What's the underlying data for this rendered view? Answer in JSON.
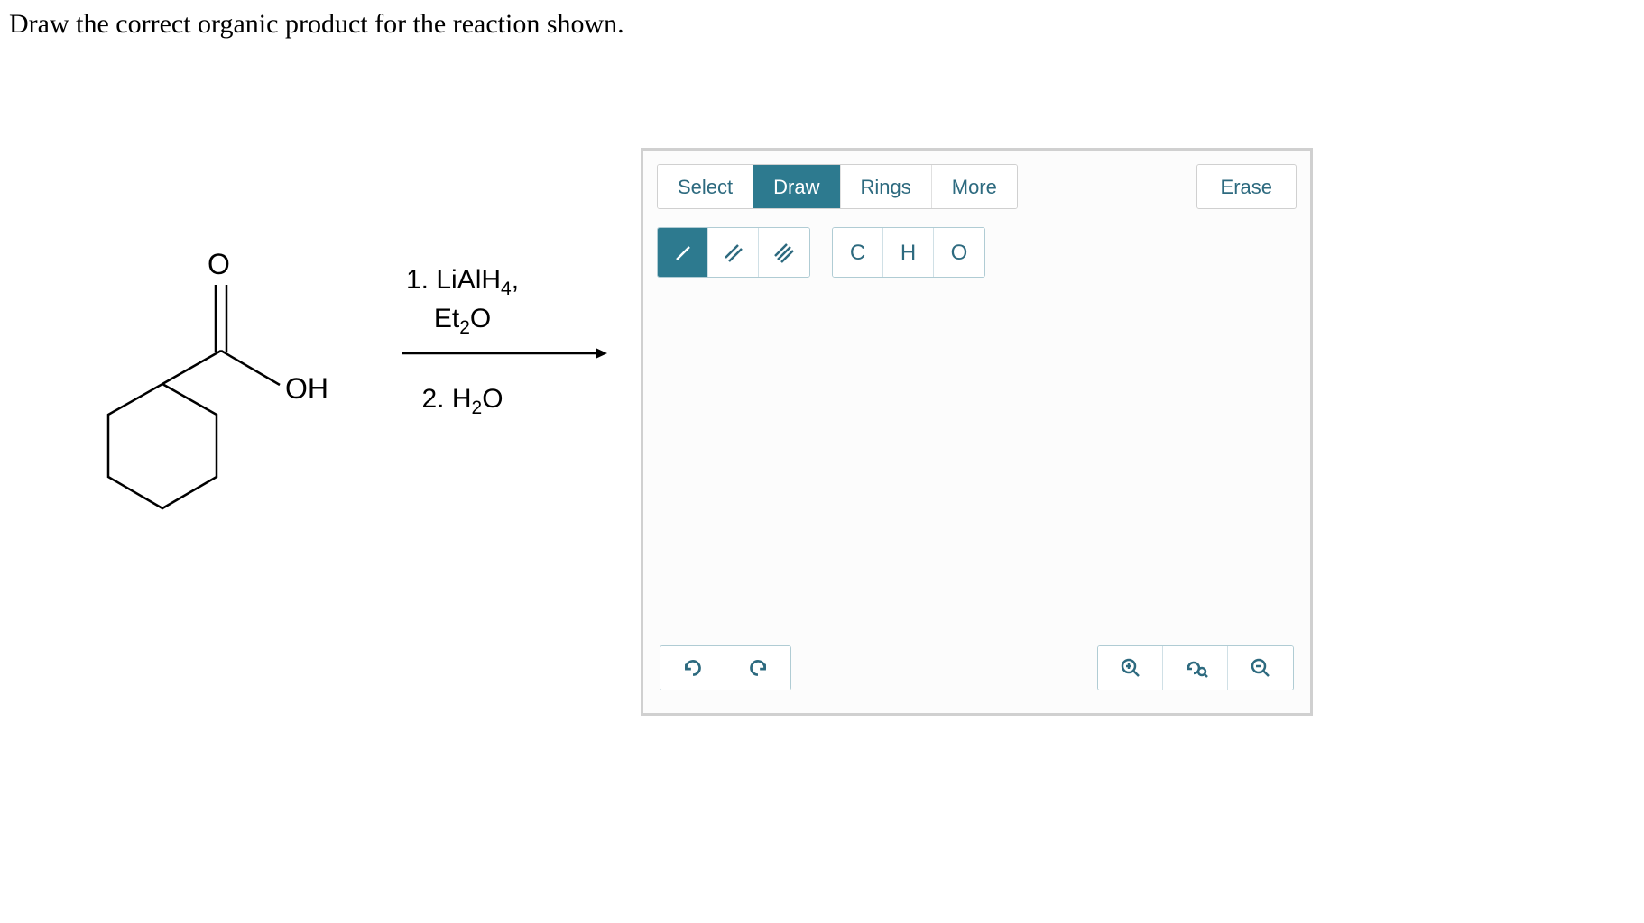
{
  "question": "Draw the correct organic product for the reaction shown.",
  "reaction": {
    "reagent_line1": "1. LiAlH",
    "reagent_line1_sub": "4",
    "reagent_line1_suffix": ",",
    "reagent_line2": "Et",
    "reagent_line2_sub": "2",
    "reagent_line2_suffix": "O",
    "reagent_line3": "2. H",
    "reagent_line3_sub": "2",
    "reagent_line3_suffix": "O",
    "carbonyl_label": "O",
    "hydroxyl_label": "OH"
  },
  "tabs": {
    "select": "Select",
    "draw": "Draw",
    "rings": "Rings",
    "more": "More",
    "erase": "Erase"
  },
  "bondTools": {
    "single": "/",
    "double": "//",
    "triple": "///"
  },
  "atomTools": {
    "c": "C",
    "h": "H",
    "o": "O"
  },
  "icons": {
    "undo": "undo",
    "redo": "redo",
    "zoom_in": "zoom-in",
    "reset_zoom": "reset-zoom",
    "zoom_out": "zoom-out"
  }
}
